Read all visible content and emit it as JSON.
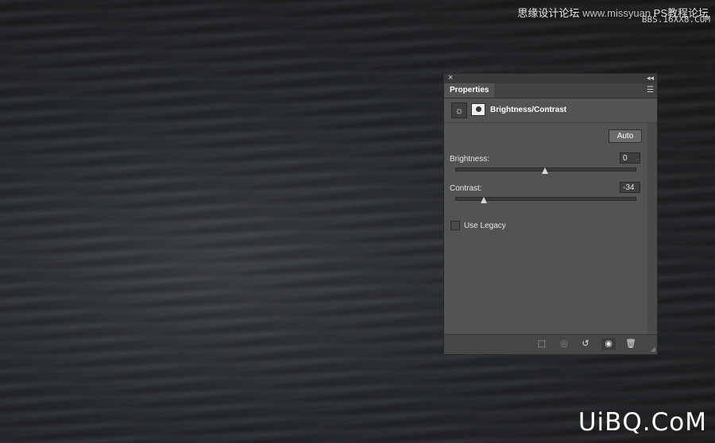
{
  "watermarks": {
    "top_cn_a": "思缘设计论坛",
    "top_cn_b": "PS教程论坛",
    "top_cn_url": "www.missyuan",
    "top_en": "BBS.16XX8.COM",
    "bottom": "UiBQ.CoM"
  },
  "panel": {
    "close_glyph": "×",
    "collapse_glyph": "◂◂",
    "tab_label": "Properties",
    "menu_glyph": "☰",
    "adjustment_title": "Brightness/Contrast",
    "auto_label": "Auto",
    "brightness": {
      "label": "Brightness:",
      "value": "0",
      "slider_position": 0.5
    },
    "contrast": {
      "label": "Contrast:",
      "value": "-34",
      "slider_position": 0.16
    },
    "use_legacy": {
      "label": "Use Legacy",
      "checked": false
    },
    "footer_icons": [
      "clip-to-layer-icon",
      "view-previous-state-icon",
      "reset-icon",
      "visibility-eye-icon",
      "trash-icon"
    ]
  }
}
